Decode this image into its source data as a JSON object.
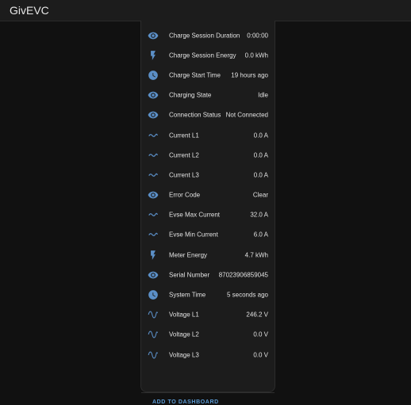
{
  "app": {
    "title": "GivEVC"
  },
  "entities": [
    {
      "label": "Charge Session Duration",
      "value": "0:00:00",
      "icon": "eye-icon"
    },
    {
      "label": "Charge Session Energy",
      "value": "0.0 kWh",
      "icon": "flash-icon"
    },
    {
      "label": "Charge Start Time",
      "value": "19 hours ago",
      "icon": "clock-icon"
    },
    {
      "label": "Charging State",
      "value": "Idle",
      "icon": "eye-icon"
    },
    {
      "label": "Connection Status",
      "value": "Not Connected",
      "icon": "eye-icon"
    },
    {
      "label": "Current L1",
      "value": "0.0 A",
      "icon": "current-ac-icon"
    },
    {
      "label": "Current L2",
      "value": "0.0 A",
      "icon": "current-ac-icon"
    },
    {
      "label": "Current L3",
      "value": "0.0 A",
      "icon": "current-ac-icon"
    },
    {
      "label": "Error Code",
      "value": "Clear",
      "icon": "eye-icon"
    },
    {
      "label": "Evse Max Current",
      "value": "32.0 A",
      "icon": "current-ac-icon"
    },
    {
      "label": "Evse Min Current",
      "value": "6.0 A",
      "icon": "current-ac-icon"
    },
    {
      "label": "Meter Energy",
      "value": "4.7 kWh",
      "icon": "flash-icon"
    },
    {
      "label": "Serial Number",
      "value": "87023906859045",
      "icon": "eye-icon"
    },
    {
      "label": "System Time",
      "value": "5 seconds ago",
      "icon": "clock-icon"
    },
    {
      "label": "Voltage L1",
      "value": "246.2 V",
      "icon": "sine-wave-icon"
    },
    {
      "label": "Voltage L2",
      "value": "0.0 V",
      "icon": "sine-wave-icon"
    },
    {
      "label": "Voltage L3",
      "value": "0.0 V",
      "icon": "sine-wave-icon"
    }
  ],
  "footer": {
    "add_to_dashboard": "ADD TO DASHBOARD"
  },
  "colors": {
    "icon": "#5b8fc7",
    "accent": "#5b9bd5",
    "background": "#111111",
    "card": "#1c1c1c"
  }
}
